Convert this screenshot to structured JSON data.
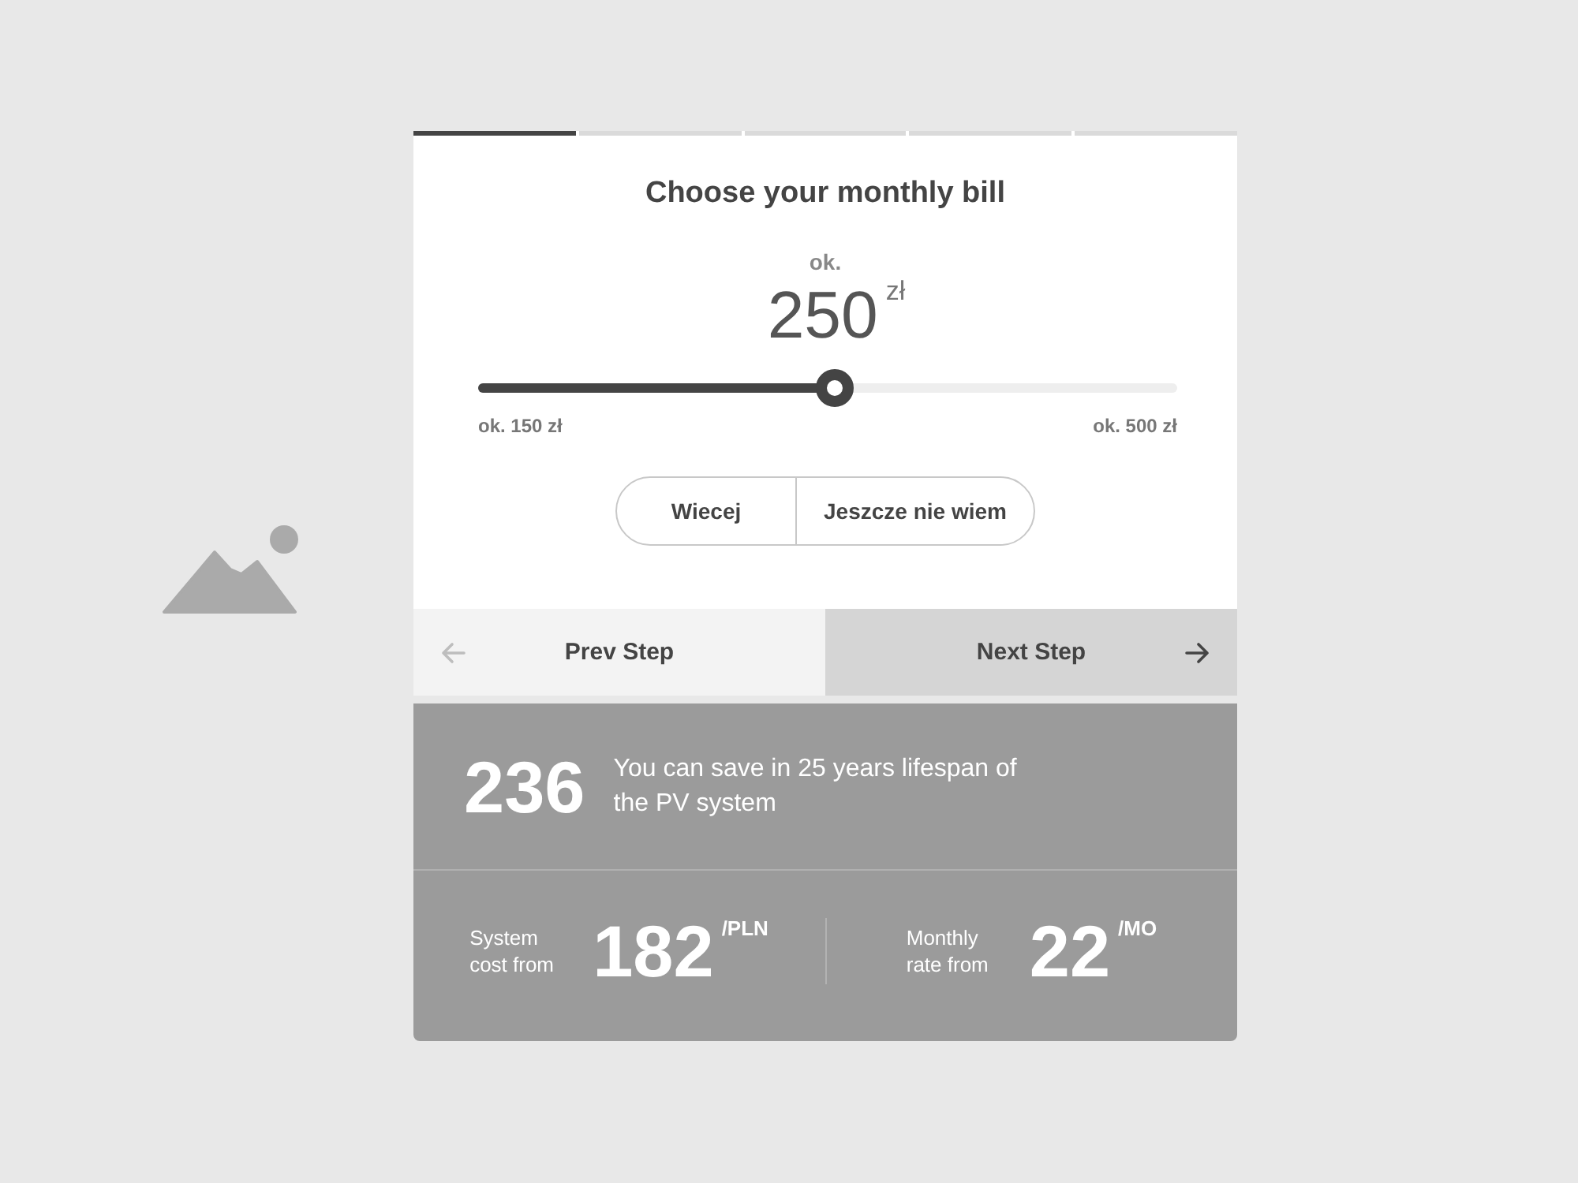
{
  "steps": [
    {
      "active": true
    },
    {
      "active": false
    },
    {
      "active": false
    },
    {
      "active": false
    },
    {
      "active": false
    }
  ],
  "title": "Choose your monthly bill",
  "amount": {
    "prefix": "ok.",
    "value": "250",
    "unit": "zł"
  },
  "slider": {
    "level": 0.51,
    "min_label": "ok. 150 zł",
    "max_label": "ok. 500 zł"
  },
  "options": [
    {
      "label": "Wiecej",
      "selected": false
    },
    {
      "label": "Jeszcze nie wiem",
      "selected": false
    }
  ],
  "nav": {
    "prev": {
      "label": "Prev Step"
    },
    "next": {
      "label": "Next Step"
    }
  },
  "savings": {
    "value": "236",
    "text": "You can save in 25 years lifespan of the PV system"
  },
  "stats": [
    {
      "label": "System cost from",
      "value": "182",
      "unit": "/PLN"
    },
    {
      "label": "Monthly rate from",
      "value": "22",
      "unit": "/MO"
    }
  ]
}
